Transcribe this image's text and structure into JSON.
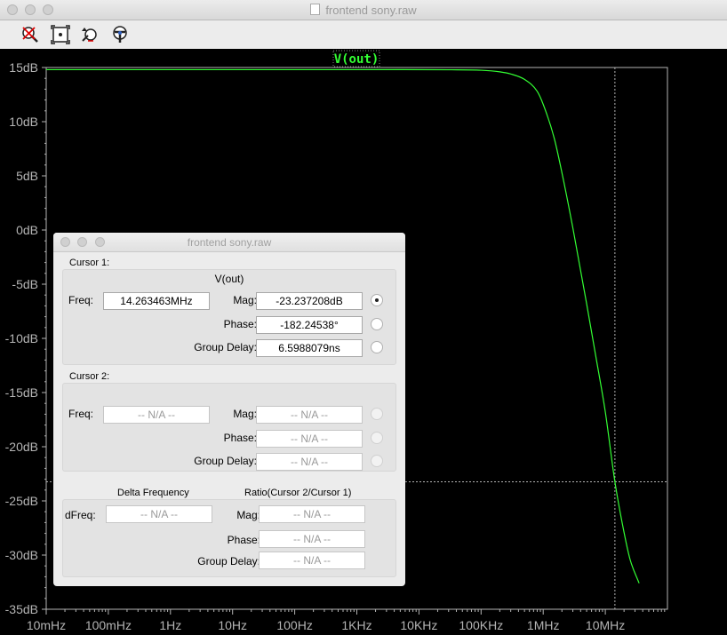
{
  "window": {
    "title": "frontend sony.raw"
  },
  "toolbar": {
    "icons": [
      "zoom-out-icon",
      "zoom-extents-icon",
      "zoom-back-icon",
      "probe-icon"
    ]
  },
  "plot": {
    "trace_label": "V(out)",
    "trace_color": "#33ff33",
    "background": "#000000",
    "cursor_freq_hz": 14263463,
    "cursor_mag_db": -23.237208
  },
  "chart_data": {
    "type": "line",
    "title": "V(out)",
    "xlabel": "",
    "ylabel": "",
    "x_scale": "log",
    "xlim": [
      0.01,
      100000000
    ],
    "ylim": [
      -35,
      15
    ],
    "x_ticks": [
      "10mHz",
      "100mHz",
      "1Hz",
      "10Hz",
      "100Hz",
      "1KHz",
      "10KHz",
      "100KHz",
      "1MHz",
      "10MHz"
    ],
    "y_ticks": [
      "15dB",
      "10dB",
      "5dB",
      "0dB",
      "-5dB",
      "-10dB",
      "-15dB",
      "-20dB",
      "-25dB",
      "-30dB",
      "-35dB"
    ],
    "grid": false,
    "series": [
      {
        "name": "V(out)",
        "x": [
          0.01,
          1000,
          30000,
          100000,
          200000,
          300000,
          500000,
          800000,
          1000000,
          1500000,
          2000000,
          3000000,
          5000000,
          7000000,
          10000000,
          14263463,
          20000000,
          25000000,
          35000000
        ],
        "y": [
          14.8,
          14.8,
          14.79,
          14.75,
          14.6,
          14.4,
          13.9,
          12.8,
          11.6,
          8.5,
          5.3,
          0.2,
          -6.8,
          -11.6,
          -16.8,
          -23.24,
          -27.9,
          -30.4,
          -32.6
        ]
      }
    ]
  },
  "dialog": {
    "title": "frontend sony.raw",
    "cursor1": {
      "title": "Cursor 1:",
      "trace": "V(out)",
      "freq_label": "Freq:",
      "freq": "14.263463MHz",
      "mag_label": "Mag:",
      "mag": "-23.237208dB",
      "phase_label": "Phase:",
      "phase": "-182.24538°",
      "gd_label": "Group Delay:",
      "gd": "6.5988079ns"
    },
    "cursor2": {
      "title": "Cursor 2:",
      "freq_label": "Freq:",
      "freq": "-- N/A --",
      "mag_label": "Mag:",
      "mag": "-- N/A --",
      "phase_label": "Phase:",
      "phase": "-- N/A --",
      "gd_label": "Group Delay:",
      "gd": "-- N/A --"
    },
    "delta": {
      "delta_freq_title": "Delta Frequency",
      "ratio_title": "Ratio(Cursor 2/Cursor 1)",
      "dfreq_label": "dFreq:",
      "dfreq": "-- N/A --",
      "mag_label": "Mag:",
      "mag": "-- N/A --",
      "phase_label": "Phase:",
      "phase": "-- N/A --",
      "gd_label": "Group Delay:",
      "gd": "-- N/A --"
    }
  }
}
